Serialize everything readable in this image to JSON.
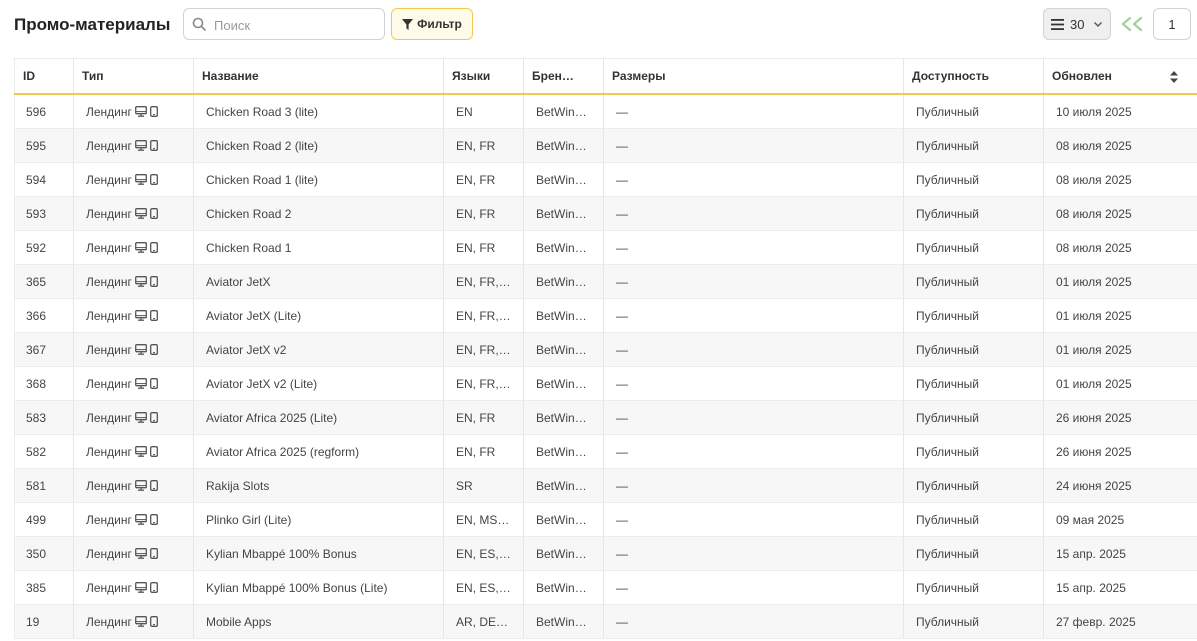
{
  "header": {
    "title": "Промо-материалы",
    "search_placeholder": "Поиск",
    "filter_label": "Фильтр",
    "page_size": "30",
    "current_page": "1"
  },
  "columns": [
    "ID",
    "Тип",
    "Название",
    "Языки",
    "Брен…",
    "Размеры",
    "Доступность",
    "Обновлен"
  ],
  "rows": [
    {
      "id": "596",
      "type": "Лендинг",
      "name": "Chicken Road 3 (lite)",
      "langs": "EN",
      "brand": "BetWinn…",
      "sizes": "—",
      "access": "Публичный",
      "updated": "10 июля 2025"
    },
    {
      "id": "595",
      "type": "Лендинг",
      "name": "Chicken Road 2 (lite)",
      "langs": "EN, FR",
      "brand": "BetWinn…",
      "sizes": "—",
      "access": "Публичный",
      "updated": "08 июля 2025"
    },
    {
      "id": "594",
      "type": "Лендинг",
      "name": "Chicken Road 1 (lite)",
      "langs": "EN, FR",
      "brand": "BetWinn…",
      "sizes": "—",
      "access": "Публичный",
      "updated": "08 июля 2025"
    },
    {
      "id": "593",
      "type": "Лендинг",
      "name": "Chicken Road 2",
      "langs": "EN, FR",
      "brand": "BetWinn…",
      "sizes": "—",
      "access": "Публичный",
      "updated": "08 июля 2025"
    },
    {
      "id": "592",
      "type": "Лендинг",
      "name": "Chicken Road 1",
      "langs": "EN, FR",
      "brand": "BetWinn…",
      "sizes": "—",
      "access": "Публичный",
      "updated": "08 июля 2025"
    },
    {
      "id": "365",
      "type": "Лендинг",
      "name": "Aviator JetX",
      "langs": "EN, FR, PT",
      "brand": "BetWinn…",
      "sizes": "—",
      "access": "Публичный",
      "updated": "01 июля 2025"
    },
    {
      "id": "366",
      "type": "Лендинг",
      "name": "Aviator JetX (Lite)",
      "langs": "EN, FR, PT",
      "brand": "BetWinn…",
      "sizes": "—",
      "access": "Публичный",
      "updated": "01 июля 2025"
    },
    {
      "id": "367",
      "type": "Лендинг",
      "name": "Aviator JetX v2",
      "langs": "EN, FR, PT",
      "brand": "BetWinn…",
      "sizes": "—",
      "access": "Публичный",
      "updated": "01 июля 2025"
    },
    {
      "id": "368",
      "type": "Лендинг",
      "name": "Aviator JetX v2 (Lite)",
      "langs": "EN, FR, PT",
      "brand": "BetWinn…",
      "sizes": "—",
      "access": "Публичный",
      "updated": "01 июля 2025"
    },
    {
      "id": "583",
      "type": "Лендинг",
      "name": "Aviator Africa 2025 (Lite)",
      "langs": "EN, FR",
      "brand": "BetWinn…",
      "sizes": "—",
      "access": "Публичный",
      "updated": "26 июня 2025"
    },
    {
      "id": "582",
      "type": "Лендинг",
      "name": "Aviator Africa 2025 (regform)",
      "langs": "EN, FR",
      "brand": "BetWinn…",
      "sizes": "—",
      "access": "Публичный",
      "updated": "26 июня 2025"
    },
    {
      "id": "581",
      "type": "Лендинг",
      "name": "Rakija Slots",
      "langs": "SR",
      "brand": "BetWinn…",
      "sizes": "—",
      "access": "Публичный",
      "updated": "24 июня 2025"
    },
    {
      "id": "499",
      "type": "Лендинг",
      "name": "Plinko Girl (Lite)",
      "langs": "EN, MS, …",
      "brand": "BetWinn…",
      "sizes": "—",
      "access": "Публичный",
      "updated": "09 мая 2025"
    },
    {
      "id": "350",
      "type": "Лендинг",
      "name": "Kylian Mbappé 100% Bonus",
      "langs": "EN, ES, F…",
      "brand": "BetWinn…",
      "sizes": "—",
      "access": "Публичный",
      "updated": "15 апр. 2025"
    },
    {
      "id": "385",
      "type": "Лендинг",
      "name": "Kylian Mbappé 100% Bonus (Lite)",
      "langs": "EN, ES, F…",
      "brand": "BetWinn…",
      "sizes": "—",
      "access": "Публичный",
      "updated": "15 апр. 2025"
    },
    {
      "id": "19",
      "type": "Лендинг",
      "name": "Mobile Apps",
      "langs": "AR, DE, …",
      "brand": "BetWinn…",
      "sizes": "—",
      "access": "Публичный",
      "updated": "27 февр. 2025"
    }
  ]
}
